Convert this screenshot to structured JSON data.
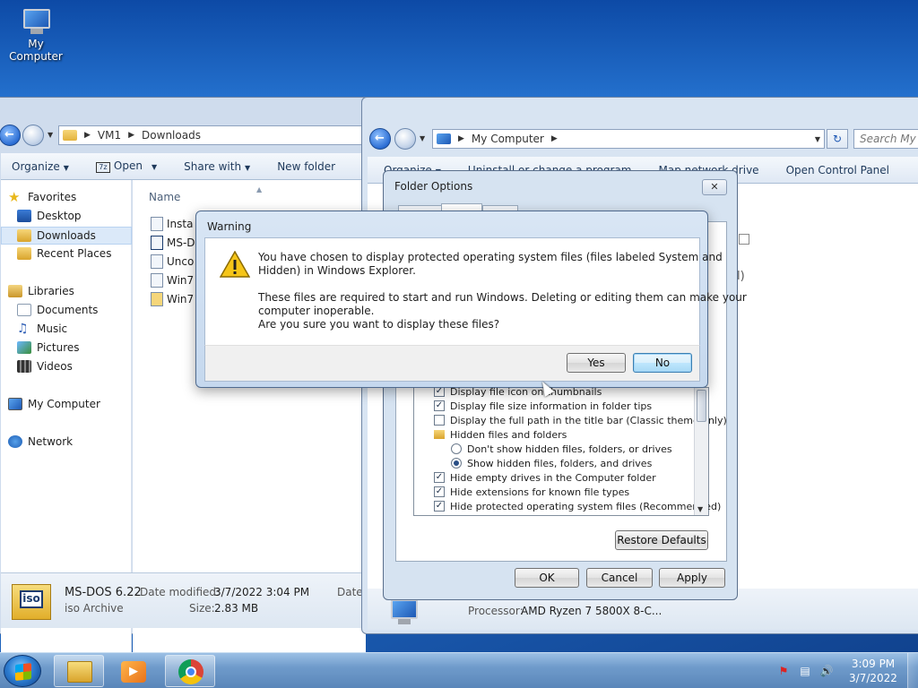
{
  "desktop": {
    "icons": [
      {
        "label": "My Computer",
        "icon": "computer-icon"
      }
    ]
  },
  "explorer_downloads": {
    "breadcrumb": [
      "VM1",
      "Downloads"
    ],
    "toolbar": {
      "organize": "Organize",
      "open": "Open",
      "share_with": "Share with",
      "new_folder": "New folder"
    },
    "nav": {
      "favorites": "Favorites",
      "desktop": "Desktop",
      "downloads": "Downloads",
      "recent_places": "Recent Places",
      "libraries": "Libraries",
      "documents": "Documents",
      "music": "Music",
      "pictures": "Pictures",
      "videos": "Videos",
      "my_computer": "My Computer",
      "network": "Network"
    },
    "column_name": "Name",
    "files": [
      "Insta",
      "MS-D",
      "Unco",
      "Win7",
      "Win7"
    ],
    "details": {
      "name": "MS-DOS 6.22",
      "type": "iso Archive",
      "date_modified_label": "Date modified:",
      "date_modified": "3/7/2022 3:04 PM",
      "size_label": "Size:",
      "size": "2.83 MB",
      "date_label": "Date",
      "icon_text": "iso"
    }
  },
  "explorer_computer": {
    "breadcrumb": [
      "My Computer"
    ],
    "search_placeholder": "Search My C",
    "toolbar": {
      "organize": "Organize",
      "uninstall": "Uninstall or change a program",
      "map_drive": "Map network drive",
      "open_control_panel": "Open Control Panel"
    },
    "fragment": "l)",
    "processor_label": "Processor:",
    "processor_value": "AMD Ryzen 7 5800X 8-C..."
  },
  "folder_options": {
    "title": "Folder Options",
    "settings": [
      {
        "type": "checkbox",
        "checked": true,
        "label": "Display file icon on thumbnails"
      },
      {
        "type": "checkbox",
        "checked": true,
        "label": "Display file size information in folder tips"
      },
      {
        "type": "checkbox",
        "checked": false,
        "label": "Display the full path in the title bar (Classic theme only)"
      },
      {
        "type": "folder",
        "label": "Hidden files and folders"
      },
      {
        "type": "radio",
        "checked": false,
        "label": "Don't show hidden files, folders, or drives"
      },
      {
        "type": "radio",
        "checked": true,
        "label": "Show hidden files, folders, and drives"
      },
      {
        "type": "checkbox",
        "checked": true,
        "label": "Hide empty drives in the Computer folder"
      },
      {
        "type": "checkbox",
        "checked": true,
        "label": "Hide extensions for known file types"
      },
      {
        "type": "checkbox",
        "checked": true,
        "label": "Hide protected operating system files (Recommended)"
      }
    ],
    "restore_defaults": "Restore Defaults",
    "ok": "OK",
    "cancel": "Cancel",
    "apply": "Apply"
  },
  "warning": {
    "title": "Warning",
    "line1": "You have chosen to display protected operating system files (files labeled System and",
    "line2": "Hidden) in Windows Explorer.",
    "line3": "These files are required to start and run Windows. Deleting or editing them can make your",
    "line4": "computer inoperable.",
    "line5": "Are you sure you want to display these files?",
    "yes": "Yes",
    "no": "No"
  },
  "taskbar": {
    "apps": [
      "windows-explorer-icon",
      "media-player-icon",
      "chrome-icon"
    ],
    "time": "3:09 PM",
    "date": "3/7/2022"
  }
}
